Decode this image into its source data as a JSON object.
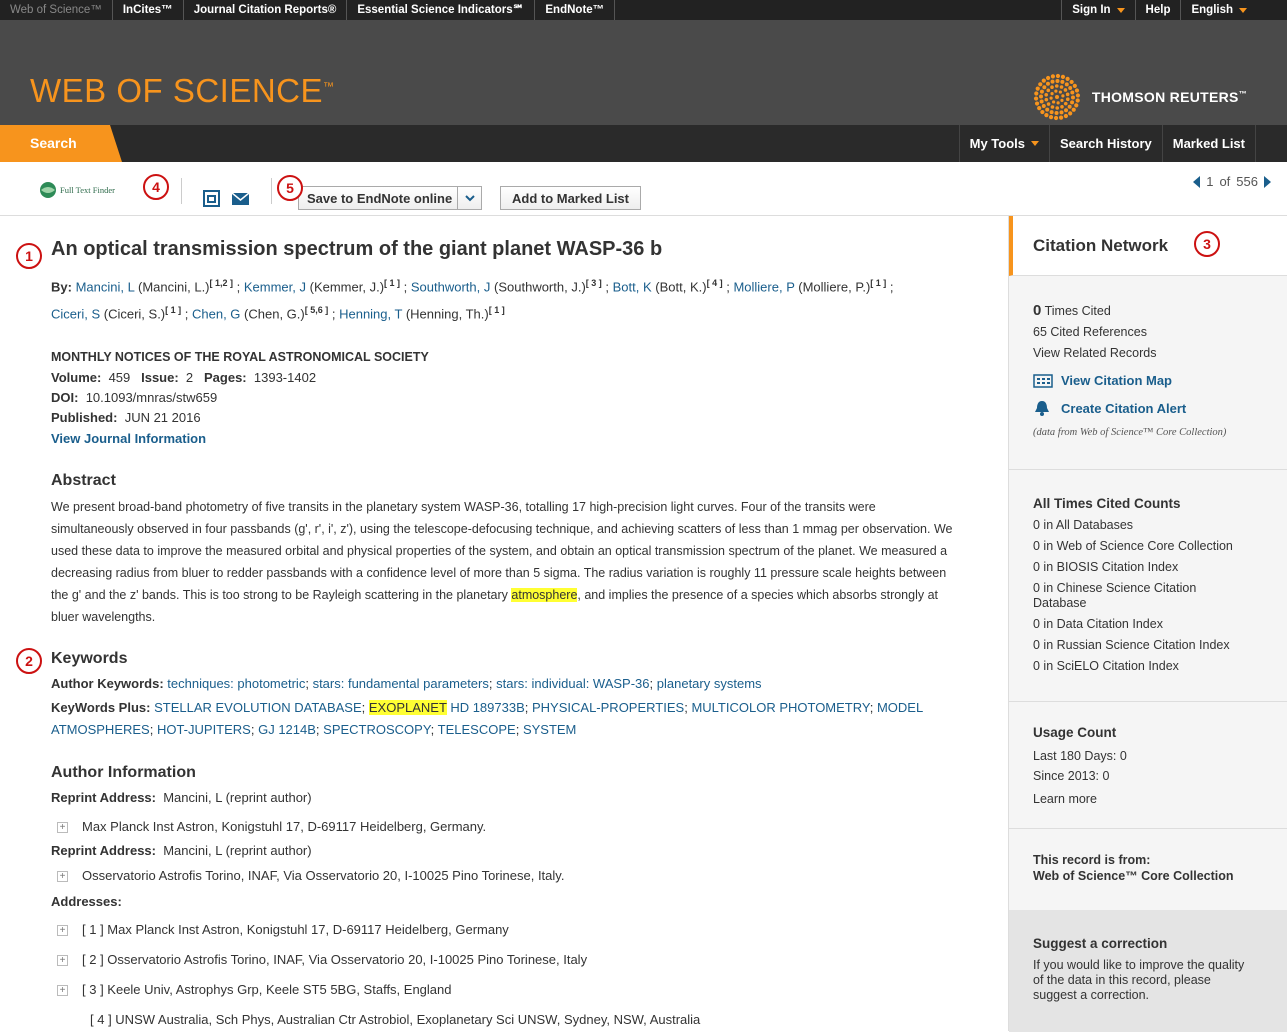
{
  "topbar": {
    "left": [
      "Web of Science™",
      "InCites™",
      "Journal Citation Reports®",
      "Essential Science Indicators℠",
      "EndNote™"
    ],
    "right": {
      "signin": "Sign In",
      "help": "Help",
      "language": "English"
    }
  },
  "header": {
    "brand": "WEB OF SCIENCE",
    "brand_tm": "™",
    "partner": "THOMSON REUTERS",
    "partner_tm": "™"
  },
  "nav": {
    "search": "Search",
    "my_tools": "My Tools",
    "history": "Search History",
    "marked": "Marked List"
  },
  "toolbar": {
    "full_text": "Full Text Finder",
    "save": "Save to EndNote online",
    "add_marked": "Add to Marked List",
    "page_current": "1",
    "page_of": "of",
    "page_total": "556"
  },
  "markers": [
    "1",
    "2",
    "3",
    "4",
    "5"
  ],
  "record": {
    "title": "An optical transmission spectrum of the giant planet WASP-36 b",
    "by_label": "By:",
    "authors": [
      {
        "short": "Mancini, L",
        "full": "(Mancini, L.)",
        "aff": "[ 1,2 ]"
      },
      {
        "short": "Kemmer, J",
        "full": "(Kemmer, J.)",
        "aff": "[ 1 ]"
      },
      {
        "short": "Southworth, J",
        "full": "(Southworth, J.)",
        "aff": "[ 3 ]"
      },
      {
        "short": "Bott, K",
        "full": "(Bott, K.)",
        "aff": "[ 4 ]"
      },
      {
        "short": "Molliere, P",
        "full": "(Molliere, P.)",
        "aff": "[ 1 ]"
      },
      {
        "short": "Ciceri, S",
        "full": "(Ciceri, S.)",
        "aff": "[ 1 ]"
      },
      {
        "short": "Chen, G",
        "full": "(Chen, G.)",
        "aff": "[ 5,6 ]"
      },
      {
        "short": "Henning, T",
        "full": "(Henning, Th.)",
        "aff": "[ 1 ]"
      }
    ],
    "journal": "MONTHLY NOTICES OF THE ROYAL ASTRONOMICAL SOCIETY",
    "volume_label": "Volume:",
    "volume": "459",
    "issue_label": "Issue:",
    "issue": "2",
    "pages_label": "Pages:",
    "pages": "1393-1402",
    "doi_label": "DOI:",
    "doi": "10.1093/mnras/stw659",
    "published_label": "Published:",
    "published": "JUN 21 2016",
    "view_journal": "View Journal Information",
    "abstract_heading": "Abstract",
    "abstract_pre": "We present broad-band photometry of five transits in the planetary system WASP-36, totalling 17 high-precision light curves. Four of the transits were simultaneously observed in four passbands (g', r', i', z'), using the telescope-defocusing technique, and achieving scatters of less than 1 mmag per observation. We used these data to improve the measured orbital and physical properties of the system, and obtain an optical transmission spectrum of the planet. We measured a decreasing radius from bluer to redder passbands with a confidence level of more than 5 sigma. The radius variation is roughly 11 pressure scale heights between the g' and the z' bands. This is too strong to be Rayleigh scattering in the planetary ",
    "abstract_highlight": "atmosphere",
    "abstract_post": ", and implies the presence of a species which absorbs strongly at bluer wavelengths.",
    "keywords_heading": "Keywords",
    "author_kw_label": "Author Keywords:",
    "author_kw": [
      "techniques: photometric",
      "stars: fundamental parameters",
      "stars: individual: WASP-36",
      "planetary systems"
    ],
    "kwplus_label": "KeyWords Plus:",
    "kwplus": [
      "STELLAR EVOLUTION DATABASE",
      "EXOPLANET",
      "HD 189733B",
      "PHYSICAL-PROPERTIES",
      "MULTICOLOR PHOTOMETRY",
      "MODEL ATMOSPHERES",
      "HOT-JUPITERS",
      "GJ 1214B",
      "SPECTROSCOPY",
      "TELESCOPE",
      "SYSTEM"
    ],
    "author_info_heading": "Author Information",
    "reprint_label": "Reprint Address:",
    "reprint1": "Mancini, L (reprint author)",
    "reprint1_addr": "Max Planck Inst Astron, Konigstuhl 17, D-69117 Heidelberg, Germany.",
    "reprint2": "Mancini, L (reprint author)",
    "reprint2_addr": "Osservatorio Astrofis Torino, INAF, Via Osservatorio 20, I-10025 Pino Torinese, Italy.",
    "addresses_label": "Addresses:",
    "addresses": [
      "[ 1 ] Max Planck Inst Astron, Konigstuhl 17, D-69117 Heidelberg, Germany",
      "[ 2 ] Osservatorio Astrofis Torino, INAF, Via Osservatorio 20, I-10025 Pino Torinese, Italy",
      "[ 3 ] Keele Univ, Astrophys Grp, Keele ST5 5BG, Staffs, England",
      "[ 4 ] UNSW Australia, Sch Phys, Australian Ctr Astrobiol, Exoplanetary Sci UNSW, Sydney, NSW, Australia"
    ]
  },
  "sidebar": {
    "heading": "Citation Network",
    "times_cited_count": "0",
    "times_cited_label": "Times Cited",
    "cited_refs": "65 Cited References",
    "related": "View Related Records",
    "citation_map": "View Citation Map",
    "citation_alert": "Create Citation Alert",
    "data_note": "(data from Web of Science™ Core Collection)",
    "counts_heading": "All Times Cited Counts",
    "counts": [
      "0 in All Databases",
      "0 in Web of Science Core Collection",
      "0 in BIOSIS Citation Index",
      "0 in Chinese Science Citation",
      "Database",
      "0 in Data Citation Index",
      "0 in Russian Science Citation Index",
      "0 in SciELO Citation Index"
    ],
    "usage_heading": "Usage Count",
    "usage_180": "Last 180 Days: 0",
    "usage_2013": "Since 2013: 0",
    "learn_more": "Learn more",
    "from_label": "This record is from:",
    "from_value": "Web of Science™ Core Collection",
    "correction_heading": "Suggest a correction",
    "correction_text1": "If you would like to improve the quality",
    "correction_text2": "of the data in this record, please",
    "correction_link": "suggest a correction."
  },
  "colors": {
    "accent": "#f7941d",
    "link": "#1a5e8c",
    "highlight": "#ffff33",
    "marker": "#cc1111"
  }
}
